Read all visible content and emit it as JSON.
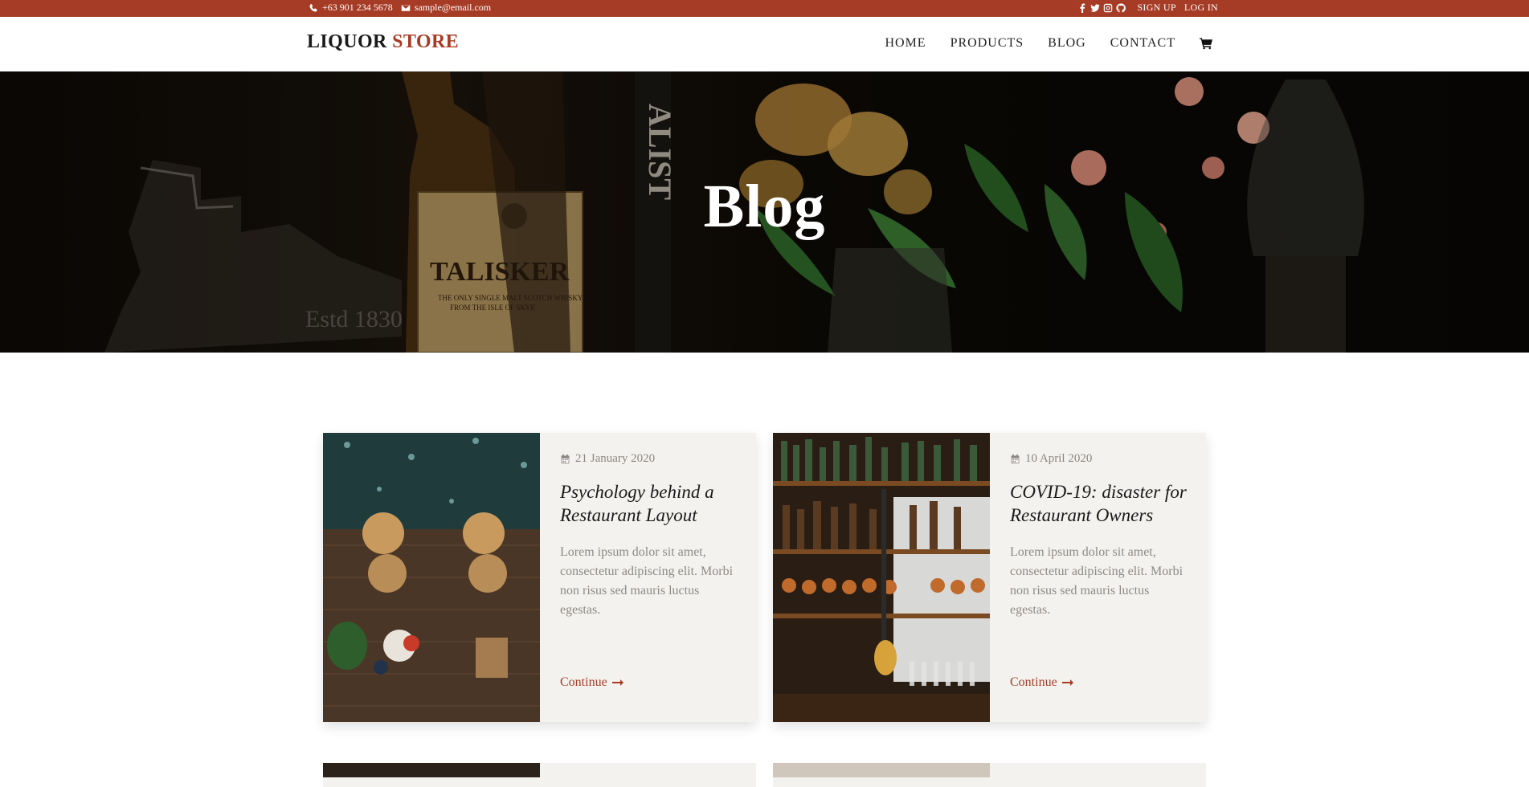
{
  "topbar": {
    "phone": "+63 901 234 5678",
    "email": "sample@email.com",
    "social_icons": [
      "facebook-icon",
      "twitter-icon",
      "instagram-icon",
      "github-icon"
    ],
    "signup": "SIGN UP",
    "login": "LOG IN"
  },
  "brand": {
    "word1": "LIQUOR",
    "word2": "STORE"
  },
  "nav": {
    "items": [
      "HOME",
      "PRODUCTS",
      "BLOG",
      "CONTACT"
    ],
    "cart_icon": "shopping-cart-icon"
  },
  "hero": {
    "title": "Blog"
  },
  "posts": [
    {
      "date": "21 January 2020",
      "title": "Psychology behind a Restaurant Layout",
      "excerpt": "Lorem ipsum dolor sit amet, consectetur adipiscing elit. Morbi non risus sed mauris luctus egestas.",
      "link": "Continue"
    },
    {
      "date": "10 April 2020",
      "title": "COVID-19: disaster for Restaurant Owners",
      "excerpt": "Lorem ipsum dolor sit amet, consectetur adipiscing elit. Morbi non risus sed mauris luctus egestas.",
      "link": "Continue"
    }
  ],
  "colors": {
    "accent": "#a63c26",
    "card_bg": "#f4f2ef",
    "muted_text": "#8d8a85"
  }
}
